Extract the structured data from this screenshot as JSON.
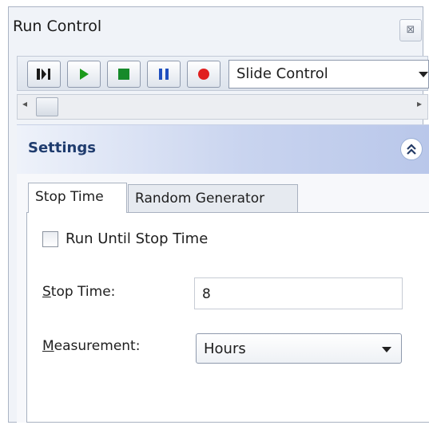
{
  "window": {
    "title": "Run Control",
    "close_glyph": "⊠"
  },
  "toolbar": {
    "buttons": [
      {
        "icon": "step-forward-icon"
      },
      {
        "icon": "play-icon",
        "color": "#1b9a1b"
      },
      {
        "icon": "stop-icon",
        "color": "#168a2a"
      },
      {
        "icon": "pause-icon",
        "color": "#1f4fbf"
      },
      {
        "icon": "record-icon",
        "color": "#e0201f"
      }
    ],
    "mode_dropdown": {
      "value": "Slide Control"
    }
  },
  "scrollbar": {
    "left_arrow": "◂",
    "right_arrow": "▸"
  },
  "settings": {
    "title": "Settings",
    "collapse_glyph": "≈",
    "tabs": [
      {
        "label": "Stop Time",
        "active": true
      },
      {
        "label": "Random Generator",
        "active": false
      }
    ],
    "run_until_stop_time": {
      "label": "Run Until Stop Time",
      "checked": false
    },
    "stop_time": {
      "label_underlined": "S",
      "label_rest": "top Time:",
      "value": "8"
    },
    "measurement": {
      "label_underlined": "M",
      "label_rest": "easurement:",
      "value": "Hours"
    }
  }
}
